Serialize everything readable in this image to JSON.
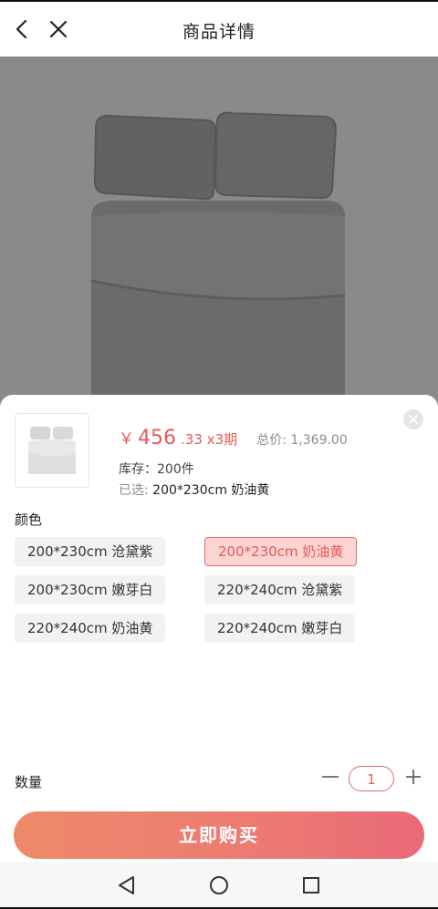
{
  "header": {
    "title": "商品详情",
    "back_icon": "chevron-left-icon",
    "close_icon": "close-icon"
  },
  "product": {
    "price_symbol": "￥",
    "price_main": "456",
    "price_decimal_installments": ".33 x3期",
    "total": "总价: 1,369.00",
    "stock": "库存：200件",
    "selected_label": "已选:",
    "selected_value": "200*230cm 奶油黄"
  },
  "colors": {
    "title": "颜色",
    "options": [
      "200*230cm 沧黛紫",
      "200*230cm 奶油黄",
      "200*230cm 嫩芽白",
      "220*240cm 沧黛紫",
      "220*240cm 奶油黄",
      "220*240cm 嫩芽白"
    ],
    "selected_index": 1
  },
  "quantity": {
    "label": "数量",
    "value": "1"
  },
  "buy_button": "立即购买",
  "theme": {
    "accent": "#e55a5a",
    "chip_bg": "#f2f2f2",
    "chip_active_bg": "#fcd4d2",
    "overlay": "#8a8a8a"
  }
}
